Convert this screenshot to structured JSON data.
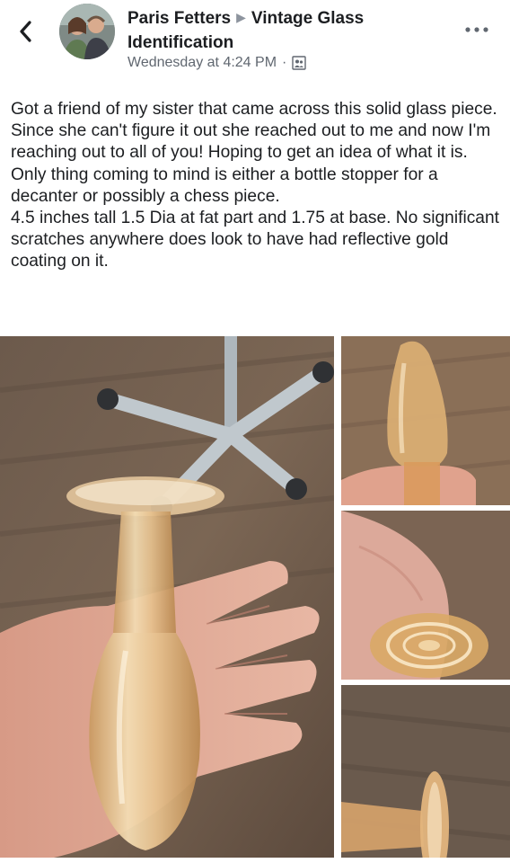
{
  "post": {
    "author": "Paris Fetters",
    "group": "Vintage Glass Identification",
    "timestamp": "Wednesday at 4:24 PM",
    "separator": "·",
    "body": "Got a friend of my sister that came across this solid glass piece. Since she can't figure it out she reached out to me and now I'm reaching out to all of you! Hoping to get an idea of what it is. Only thing coming to mind is either a bottle stopper for a decanter or possibly a chess piece.\n4.5 inches tall 1.5 Dia at fat part and 1.75 at base. No significant scratches anywhere does look to have had reflective gold coating on it."
  },
  "icons": {
    "back": "chevron-left-icon",
    "arrow": "triangle-right-icon",
    "audience": "group-audience-icon",
    "more": "more-horizontal-icon"
  },
  "colors": {
    "text": "#1c1e21",
    "meta": "#606770",
    "glass": "#d9b07a",
    "wood": "#6e5a49"
  }
}
